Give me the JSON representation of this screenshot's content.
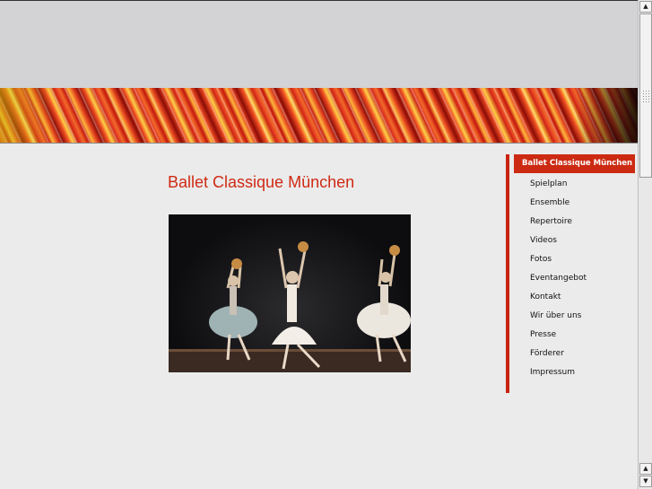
{
  "page": {
    "title": "Ballet Classique München"
  },
  "photo": {
    "icon": "ballet-dancers-photo"
  },
  "nav": {
    "items": [
      {
        "label": "Ballet Classique München",
        "active": true
      },
      {
        "label": "Spielplan"
      },
      {
        "label": "Ensemble"
      },
      {
        "label": "Repertoire"
      },
      {
        "label": "Videos"
      },
      {
        "label": "Fotos"
      },
      {
        "label": "Eventangebot"
      },
      {
        "label": "Kontakt"
      },
      {
        "label": "Wir über uns"
      },
      {
        "label": "Presse"
      },
      {
        "label": "Förderer"
      },
      {
        "label": "Impressum"
      }
    ]
  },
  "scrollbar": {
    "up_glyph": "▲",
    "down_glyph": "▼"
  },
  "colors": {
    "accent": "#cc2a12",
    "title": "#cf2a14",
    "background": "#ebebeb",
    "header": "#d3d3d5"
  }
}
